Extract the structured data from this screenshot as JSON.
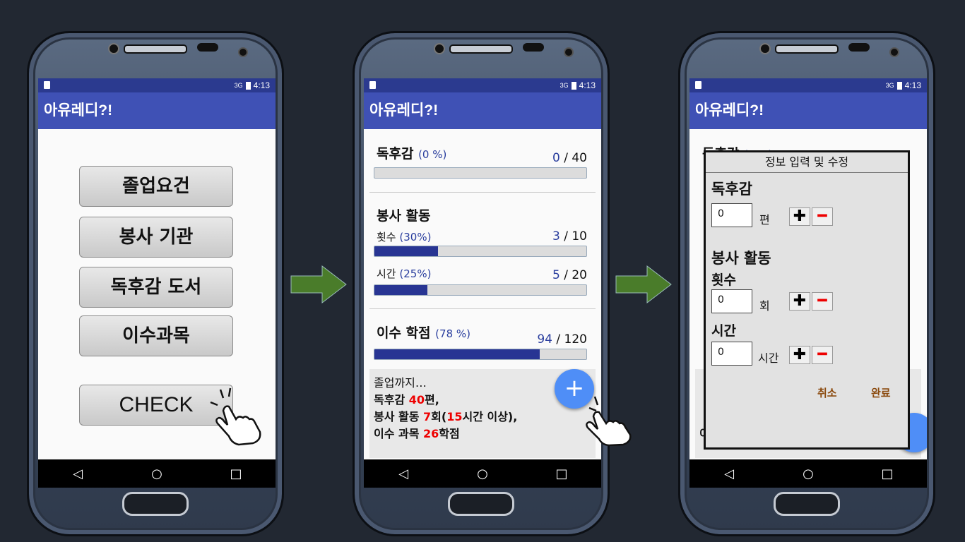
{
  "app": {
    "status_time": "4:13",
    "status_signal": "3G",
    "title": "아유레디?!"
  },
  "screen1": {
    "buttons": [
      "졸업요건",
      "봉사 기관",
      "독후감 도서",
      "이수과목"
    ],
    "check_label": "CHECK"
  },
  "screen2": {
    "reading": {
      "title": "독후감",
      "pct": "(0 %)",
      "current": "0",
      "total": "/ 40",
      "progress": 0.0
    },
    "volunteer": {
      "title": "봉사 활동",
      "count_label": "횟수",
      "count_pct": "(30%)",
      "count_current": "3",
      "count_total": "/ 10",
      "count_progress": 0.3,
      "time_label": "시간",
      "time_pct": "(25%)",
      "time_current": "5",
      "time_total": "/ 20",
      "time_progress": 0.25
    },
    "credits": {
      "title": "이수 학점",
      "pct": "(78 %)",
      "current": "94",
      "total": "/ 120",
      "progress": 0.78
    },
    "summary": {
      "line1": "졸업까지…",
      "line2_a": "독후감 ",
      "line2_n": "40",
      "line2_b": "편,",
      "line3_a": "봉사 활동 ",
      "line3_n1": "7",
      "line3_b": "회(",
      "line3_n2": "15",
      "line3_c": "시간 이상),",
      "line4_a": "이수 과목 ",
      "line4_n": "26",
      "line4_b": "학점"
    },
    "fab_label": "+"
  },
  "screen3": {
    "dialog_title": "정보 입력 및 수정",
    "reading_label": "독후감",
    "reading_value": "0",
    "reading_unit": "편",
    "volunteer_label": "봉사 활동",
    "count_label": "횟수",
    "count_value": "0",
    "count_unit": "회",
    "time_label": "시간",
    "time_value": "0",
    "time_unit": "시간",
    "plus": "✚",
    "minus": "━",
    "cancel": "취소",
    "confirm": "완료"
  },
  "nav": {
    "back": "◁",
    "home": "○",
    "recent": "□"
  },
  "colors": {
    "appbar": "#3f51b5",
    "statusbar": "#2b3a8f",
    "progress": "#283593",
    "arrow": "#4a7c2a",
    "fab": "#4f8ef7"
  }
}
